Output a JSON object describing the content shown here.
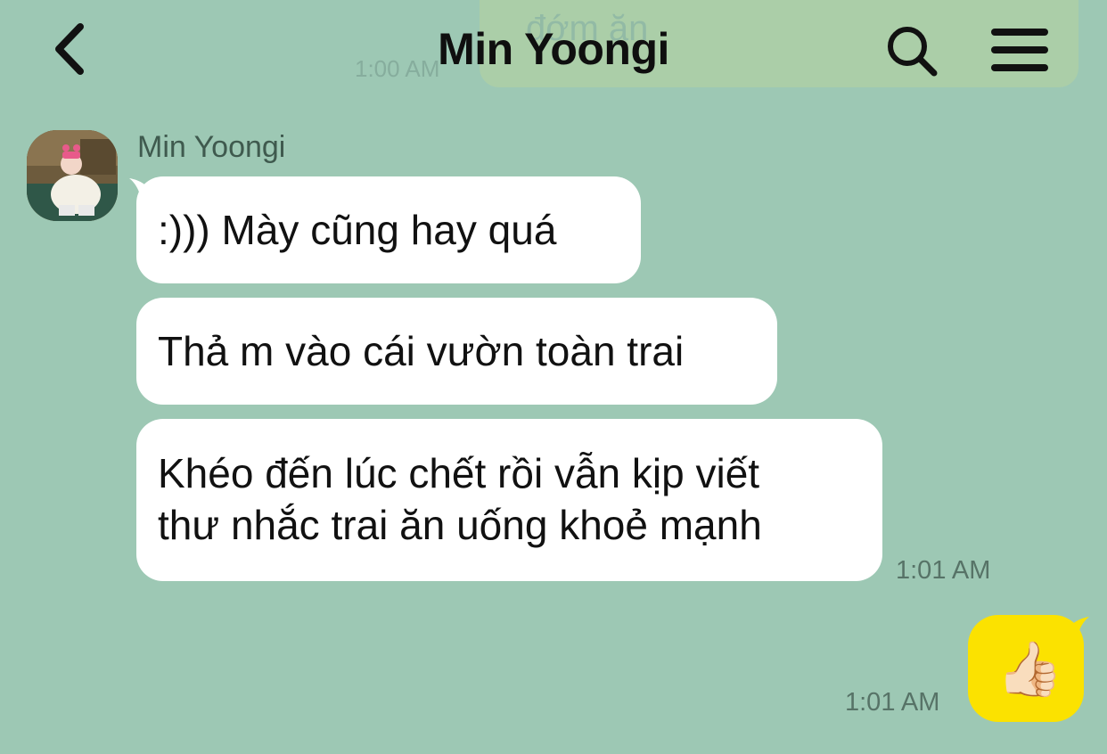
{
  "header": {
    "title": "Min Yoongi",
    "back_icon": "chevron-left-icon",
    "search_icon": "search-icon",
    "menu_icon": "menu-icon"
  },
  "previous": {
    "faded_text": "đớm ăn",
    "faded_time": "1:00 AM"
  },
  "messages": [
    {
      "sender": "Min Yoongi",
      "texts": [
        ":))) Mày cũng hay quá",
        "Thả m vào cái vườn toàn trai",
        "Khéo đến lúc chết rồi vẫn kịp viết",
        "thư nhắc trai ăn uống khoẻ mạnh"
      ],
      "time": "1:01 AM"
    },
    {
      "sender": "me",
      "emoji": "👍🏻",
      "time": "1:01 AM"
    }
  ],
  "colors": {
    "background": "#9dc8b4",
    "incoming_bubble": "#ffffff",
    "outgoing_bubble": "#fbe200"
  }
}
